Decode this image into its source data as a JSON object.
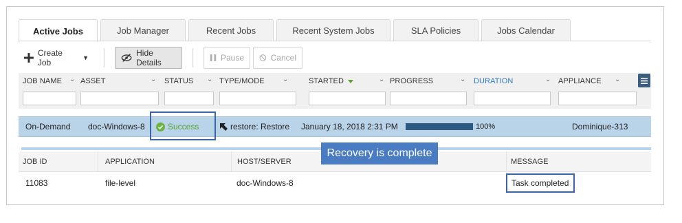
{
  "tabs": [
    {
      "label": "Active Jobs",
      "active": true
    },
    {
      "label": "Job Manager",
      "active": false
    },
    {
      "label": "Recent Jobs",
      "active": false
    },
    {
      "label": "Recent System Jobs",
      "active": false
    },
    {
      "label": "SLA Policies",
      "active": false
    },
    {
      "label": "Jobs Calendar",
      "active": false
    }
  ],
  "toolbar": {
    "create_job": "Create Job",
    "hide_details": "Hide Details",
    "pause": "Pause",
    "cancel": "Cancel"
  },
  "columns": [
    {
      "label": "JOB NAME"
    },
    {
      "label": "ASSET"
    },
    {
      "label": "STATUS"
    },
    {
      "label": "TYPE/MODE"
    },
    {
      "label": "STARTED"
    },
    {
      "label": "PROGRESS"
    },
    {
      "label": "DURATION"
    },
    {
      "label": "APPLIANCE"
    }
  ],
  "job_row": {
    "job_name": "On-Demand",
    "asset": "doc-Windows-8",
    "status": "Success",
    "type_mode": "restore: Restore",
    "started": "January 18, 2018 2:31 PM",
    "progress_text": "100%",
    "progress_value": 100,
    "appliance": "Dominique-313"
  },
  "details": {
    "headers": {
      "job_id": "JOB ID",
      "application": "APPLICATION",
      "host_server": "HOST/SERVER",
      "message": "MESSAGE"
    },
    "values": {
      "job_id": "11083",
      "application": "file-level",
      "host_server": "doc-Windows-8",
      "message": "Task completed"
    }
  },
  "callout": "Recovery is complete",
  "colors": {
    "row_highlight": "#b9d3e8",
    "success": "#6cb33f",
    "callout_bg": "#4a7cc4",
    "annotation_border": "#3a64a8",
    "progress_bar": "#2d5a84"
  }
}
